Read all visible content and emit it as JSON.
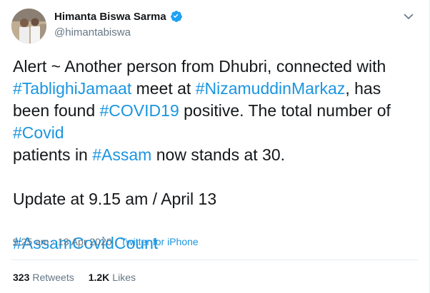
{
  "user": {
    "display_name": "Himanta Biswa Sarma",
    "handle": "@himantabiswa",
    "verified_icon": "verified-badge-icon",
    "menu_icon": "chevron-down-icon"
  },
  "tweet": {
    "p1": {
      "t1": "Alert ~ Another person from Dhubri, connected with ",
      "h1": "#TablighiJamaat",
      "t2": " meet at ",
      "h2": "#NizamuddinMarkaz",
      "t3": ", has been found ",
      "h3": "#COVID19",
      "t4": " positive. The total number of ",
      "h4": "#Covid",
      "t5": " patients in ",
      "h5": "#Assam",
      "t6": " now stands at 30."
    },
    "p2": "Update at 9.15 am / April 13",
    "p3_hashtag": "#AssamCovidCount"
  },
  "meta": {
    "timestamp": "9:25 am · 13 Apr 2020",
    "separator": " · ",
    "source": "Twitter for iPhone"
  },
  "stats": {
    "retweets_count": "323",
    "retweets_label": "Retweets",
    "likes_count": "1.2K",
    "likes_label": "Likes"
  },
  "colors": {
    "link": "#1b95e0",
    "text": "#14171a",
    "muted": "#657786"
  }
}
